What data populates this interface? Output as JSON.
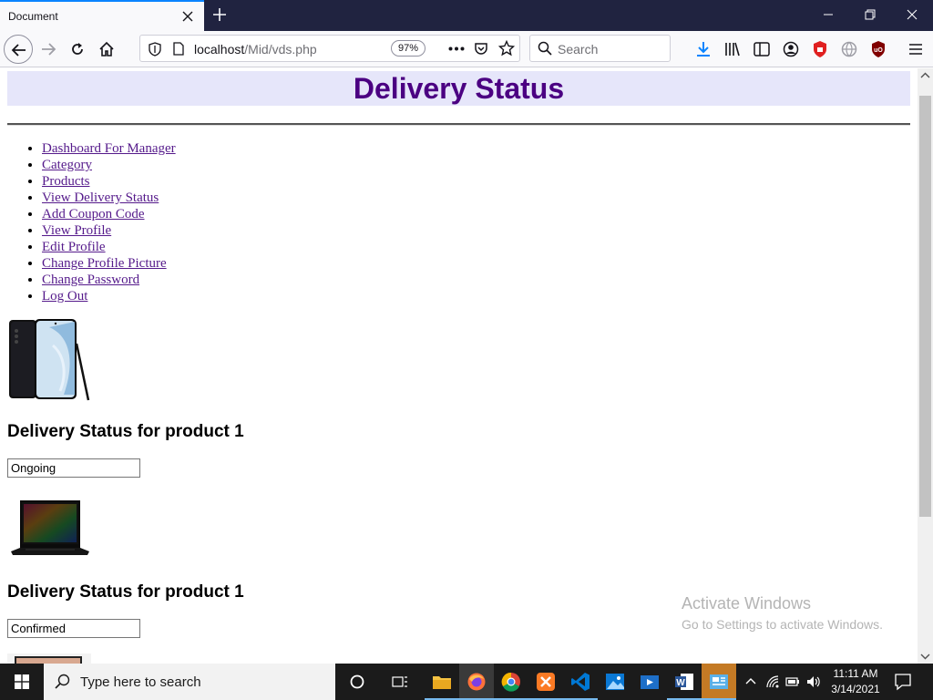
{
  "browser": {
    "tab_title": "Document",
    "url_host": "localhost",
    "url_path": "/Mid/vds.php",
    "zoom": "97%",
    "search_placeholder": "Search"
  },
  "page": {
    "title": "Delivery Status",
    "nav_links": [
      "Dashboard For Manager",
      "Category",
      "Products",
      "View Delivery Status",
      "Add Coupon Code",
      "View Profile",
      "Edit Profile",
      "Change Profile Picture",
      "Change Password",
      "Log Out"
    ],
    "products": [
      {
        "image": "phone-image",
        "heading": "Delivery Status for product 1",
        "status": "Ongoing"
      },
      {
        "image": "laptop-image",
        "heading": "Delivery Status for product 1",
        "status": "Confirmed"
      }
    ]
  },
  "watermark": {
    "line1": "Activate Windows",
    "line2": "Go to Settings to activate Windows."
  },
  "taskbar": {
    "search_placeholder": "Type here to search",
    "time": "11:11 AM",
    "date": "3/14/2021"
  },
  "colors": {
    "title": "#4b0082",
    "header_bg": "#e6e6fa",
    "link": "#551a8b",
    "tab_accent": "#0a84ff"
  }
}
